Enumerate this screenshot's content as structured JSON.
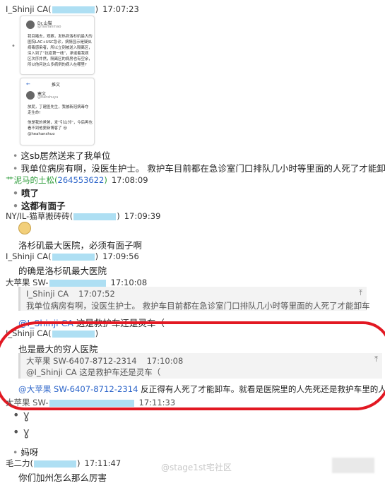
{
  "messages": {
    "m1": {
      "name": "I_Shinji CA(",
      "close": ")",
      "time": "17:07:23"
    },
    "card1": {
      "author": "Dr.山猫",
      "handle": "@Yashanmao",
      "lines": [
        "我目睹去，观察，发热到洛杉矶最大的",
        "医院LAC+USC急诊，病情显示是疑似",
        "病毒感染者，所以立刻被送入隔离区，",
        "深入到了“抗疫第一线”，承诺着我病",
        "区次序井然，隔离区的病房也有空余，",
        "所以他问这么多病例的病人在哪里?"
      ]
    },
    "card2": {
      "header": "推文",
      "author": "寒文",
      "handle": "@hanshuyu",
      "lines": [
        "放屁，丁建医先生，我被新冠病毒夺",
        "走生命!",
        "",
        "他是我的爸爸，发“引山邻”，今后再也",
        "看不到他更新博客了 😢",
        "@heahanshuo"
      ]
    },
    "t1": "这sb居然送来了我单位",
    "t2": "我单位病房有啊，没医生护士。 救护车目前都在急诊室门口排队几小时等里面的人死了才能卸车",
    "m2": {
      "name": "艹泥马的土松(",
      "id": "264553622",
      "close": ")",
      "time": "17:08:09"
    },
    "t3": "喷了",
    "t4": "这都有面子",
    "m3": {
      "name": "NY/IL-猫草搬砖砖(",
      "close": ")",
      "time": "17:09:39"
    },
    "t5": "洛杉矶最大医院，必须有面子啊",
    "m4": {
      "name": "I_Shinji CA(",
      "close": ")",
      "time": "17:09:56"
    },
    "t6": "的确是洛杉矶最大医院",
    "m5": {
      "name": "大苹果 SW-",
      "close": "",
      "time": "17:10:08"
    },
    "q1": {
      "title": "I_Shinji CA",
      "time": "17:07:52",
      "text": "我单位病房有啊，没医生护士。 救护车目前都在急诊室门口排队几小时等里面的人死了才能卸车"
    },
    "t7_mention": "@I_Shinji CA",
    "t7": " 这是救护车还是灵车（",
    "m6": {
      "name": "I_Shinji CA(",
      "close": ")"
    },
    "t8": "也是最大的穷人医院",
    "q2": {
      "title": "大苹果 SW-6407-8712-2314",
      "time": "17:10:08",
      "text": "@I_Shinji CA 这是救护车还是灵车（"
    },
    "t9_mention": "@大苹果 SW-6407-8712-2314",
    "t9": " 反正得有人死了才能卸车。就看是医院里的人先死还是救护车里的人先死",
    "m7": {
      "name": "大苹果 SW-",
      "time": "17:11:33"
    },
    "t10": "妈呀",
    "m8": {
      "name": "毛二力(",
      "close": ")",
      "time": "17:11:47"
    },
    "t11": "你们加州怎么那么厉害"
  },
  "icons": {
    "pin": "⤒",
    "sticker": "ɣ"
  },
  "watermark": "@stage1st宅社区",
  "colors": {
    "highlight_red": "#e21822",
    "mention_blue": "#2a63c9",
    "name_green": "#2d9c3a"
  }
}
